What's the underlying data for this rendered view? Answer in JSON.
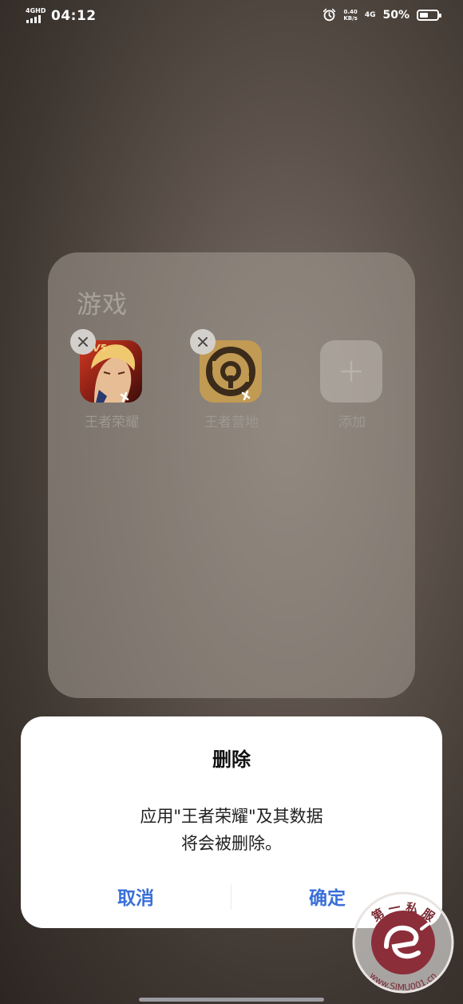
{
  "status_bar": {
    "network_type": "4GHD",
    "time": "04:12",
    "speed_value": "0.40",
    "speed_unit": "KB/s",
    "net_4g": "4G",
    "battery": "50%",
    "battery_level": 0.5
  },
  "folder": {
    "title": "游戏",
    "apps": [
      {
        "label": "王者荣耀",
        "icon": "honor-of-kings-icon"
      },
      {
        "label": "王者营地",
        "icon": "king-camp-icon"
      },
      {
        "label": "添加",
        "icon": "plus-icon"
      }
    ]
  },
  "dialog": {
    "title": "删除",
    "message_line1": "应用\"王者荣耀\"及其数据",
    "message_line2": "将会被删除。",
    "cancel": "取消",
    "confirm": "确定"
  },
  "watermark": {
    "text": "第 一 私 服",
    "url": "www.SIMU001.cn"
  },
  "colors": {
    "accent": "#3a6fd8",
    "dialog_bg": "#ffffff"
  }
}
